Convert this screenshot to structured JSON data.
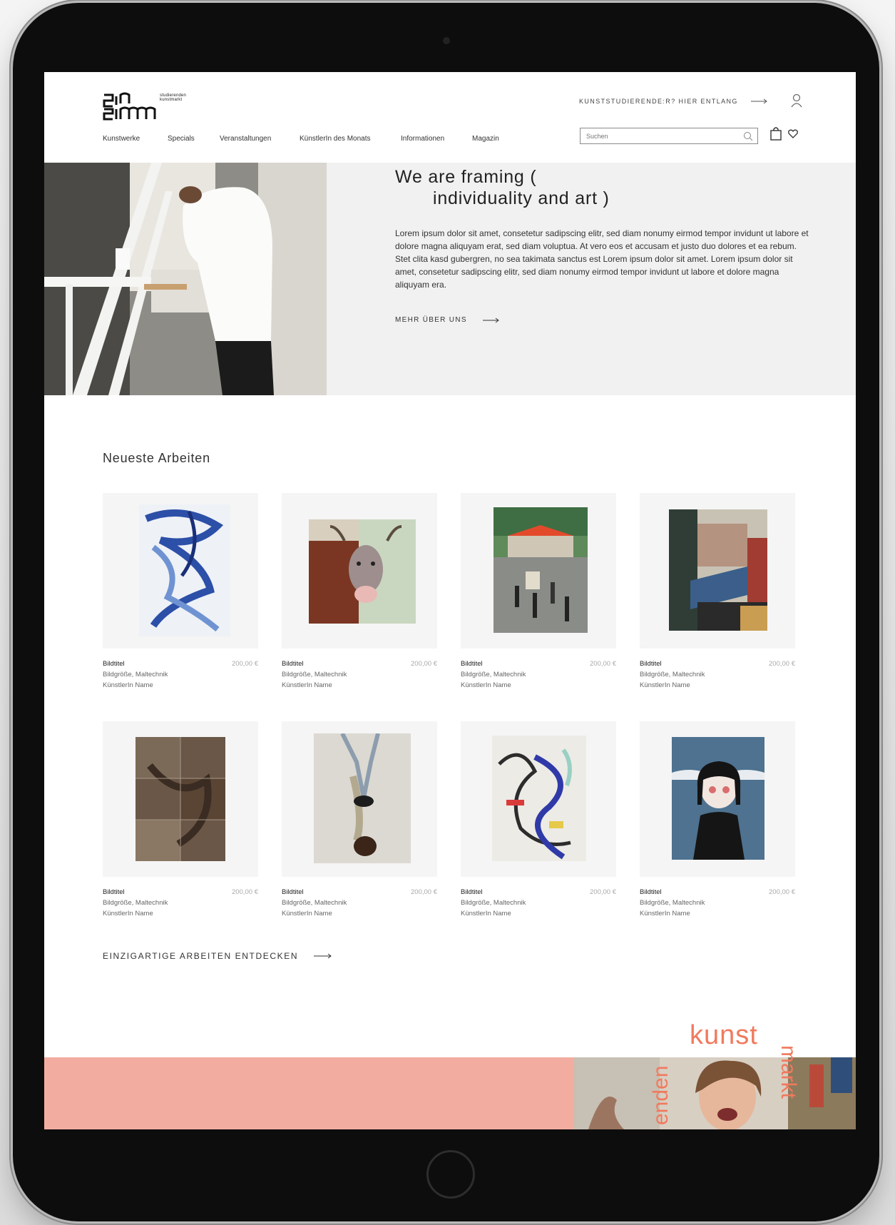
{
  "header": {
    "logo_text_line1": "studierenden",
    "logo_text_line2": "kunstmarkt",
    "top_cta": "KUNSTSTUDIERENDE:R? HIER ENTLANG",
    "nav": [
      "Kunstwerke",
      "Specials",
      "Veranstaltungen",
      "KünstlerIn des Monats",
      "Informationen",
      "Magazin"
    ],
    "search_placeholder": "Suchen"
  },
  "hero": {
    "title_line1": "We are framing (",
    "title_line2": "individuality and art )",
    "body": "Lorem ipsum dolor sit amet, consetetur sadipscing elitr, sed diam nonumy eirmod tempor invidunt ut labore et dolore magna aliquyam erat, sed diam voluptua. At vero eos et accusam et justo duo dolores et ea rebum. Stet clita kasd gubergren, no sea takimata sanctus est Lorem ipsum dolor sit amet. Lorem ipsum dolor sit amet, consetetur sadipscing elitr, sed diam nonumy eirmod tempor invidunt ut labore et dolore magna aliquyam era.",
    "link_label": "MEHR ÜBER UNS"
  },
  "artworks": {
    "section_title": "Neueste Arbeiten",
    "items": [
      {
        "title": "Bildtitel",
        "details": "Bildgröße, Maltechnik",
        "artist": "KünstlerIn Name",
        "price": "200,00 €"
      },
      {
        "title": "Bildtitel",
        "details": "Bildgröße, Maltechnik",
        "artist": "KünstlerIn Name",
        "price": "200,00 €"
      },
      {
        "title": "Bildtitel",
        "details": "Bildgröße, Maltechnik",
        "artist": "KünstlerIn Name",
        "price": "200,00 €"
      },
      {
        "title": "Bildtitel",
        "details": "Bildgröße, Maltechnik",
        "artist": "KünstlerIn Name",
        "price": "200,00 €"
      },
      {
        "title": "Bildtitel",
        "details": "Bildgröße, Maltechnik",
        "artist": "KünstlerIn Name",
        "price": "200,00 €"
      },
      {
        "title": "Bildtitel",
        "details": "Bildgröße, Maltechnik",
        "artist": "KünstlerIn Name",
        "price": "200,00 €"
      },
      {
        "title": "Bildtitel",
        "details": "Bildgröße, Maltechnik",
        "artist": "KünstlerIn Name",
        "price": "200,00 €"
      },
      {
        "title": "Bildtitel",
        "details": "Bildgröße, Maltechnik",
        "artist": "KünstlerIn Name",
        "price": "200,00 €"
      }
    ],
    "discover_label": "EINZIGARTIGE ARBEITEN ENTDECKEN"
  },
  "banner": {
    "word_kunst": "kunst",
    "word_enden": "enden",
    "word_markt": "markt",
    "color": "#f3ada0",
    "accent": "#f07a5e"
  }
}
